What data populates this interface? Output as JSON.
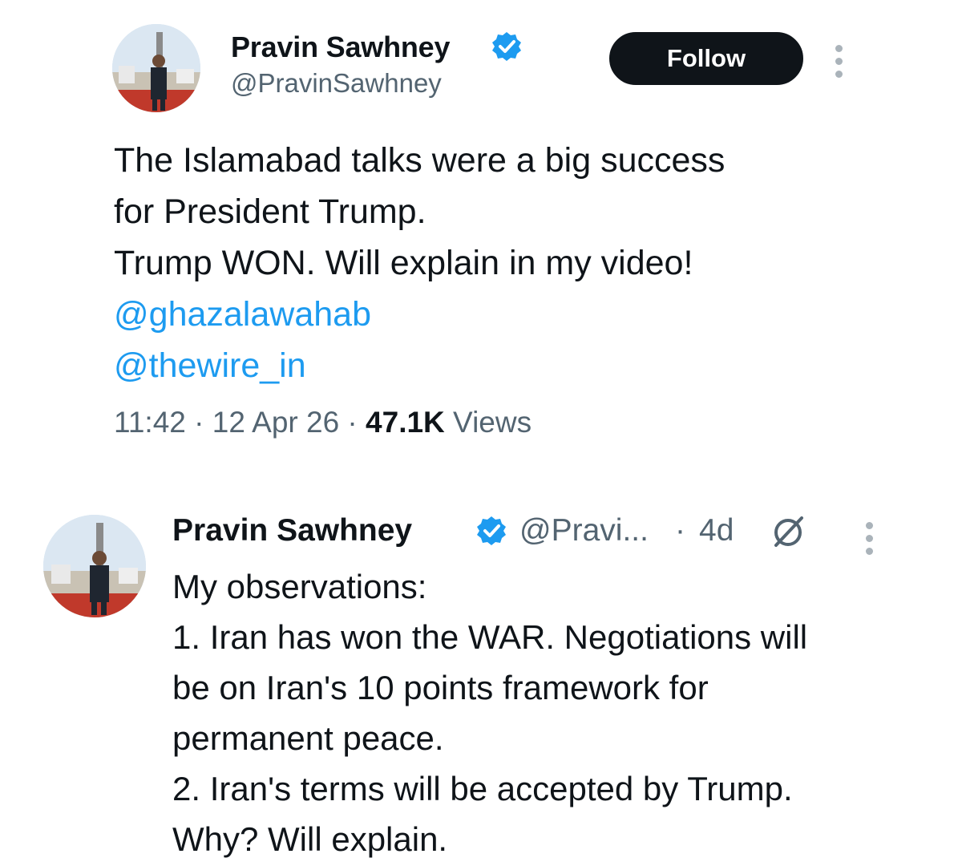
{
  "tweet_main": {
    "author_name": "Pravin Sawhney",
    "author_handle": "@PravinSawhney",
    "follow_label": "Follow",
    "body_lines": [
      "The Islamabad talks were a big success",
      "for President Trump.",
      "Trump WON. Will explain in my video!"
    ],
    "mentions": [
      "@ghazalawahab",
      "@thewire_in"
    ],
    "time": "11:42",
    "sep1": " · ",
    "date": "12 Apr 26",
    "sep2": " · ",
    "views_count": "47.1K",
    "views_label": " Views"
  },
  "tweet_quoted": {
    "author_name": "Pravin Sawhney",
    "author_handle": "@Pravi...",
    "dot": "·",
    "relative_time": "4d",
    "body_lines": [
      "My observations:",
      "1. Iran has won the WAR. Negotiations will",
      "be on Iran's 10 points framework for",
      "permanent peace.",
      "2. Iran's terms will be accepted by Trump.",
      "Why? Will explain."
    ]
  },
  "icons": {
    "verified": "verified-badge-icon",
    "more": "more-vertical-icon",
    "grok": "grok-icon"
  },
  "colors": {
    "text": "#0f1419",
    "secondary": "#536471",
    "link": "#1d9bf0",
    "follow_bg": "#0f1419"
  }
}
